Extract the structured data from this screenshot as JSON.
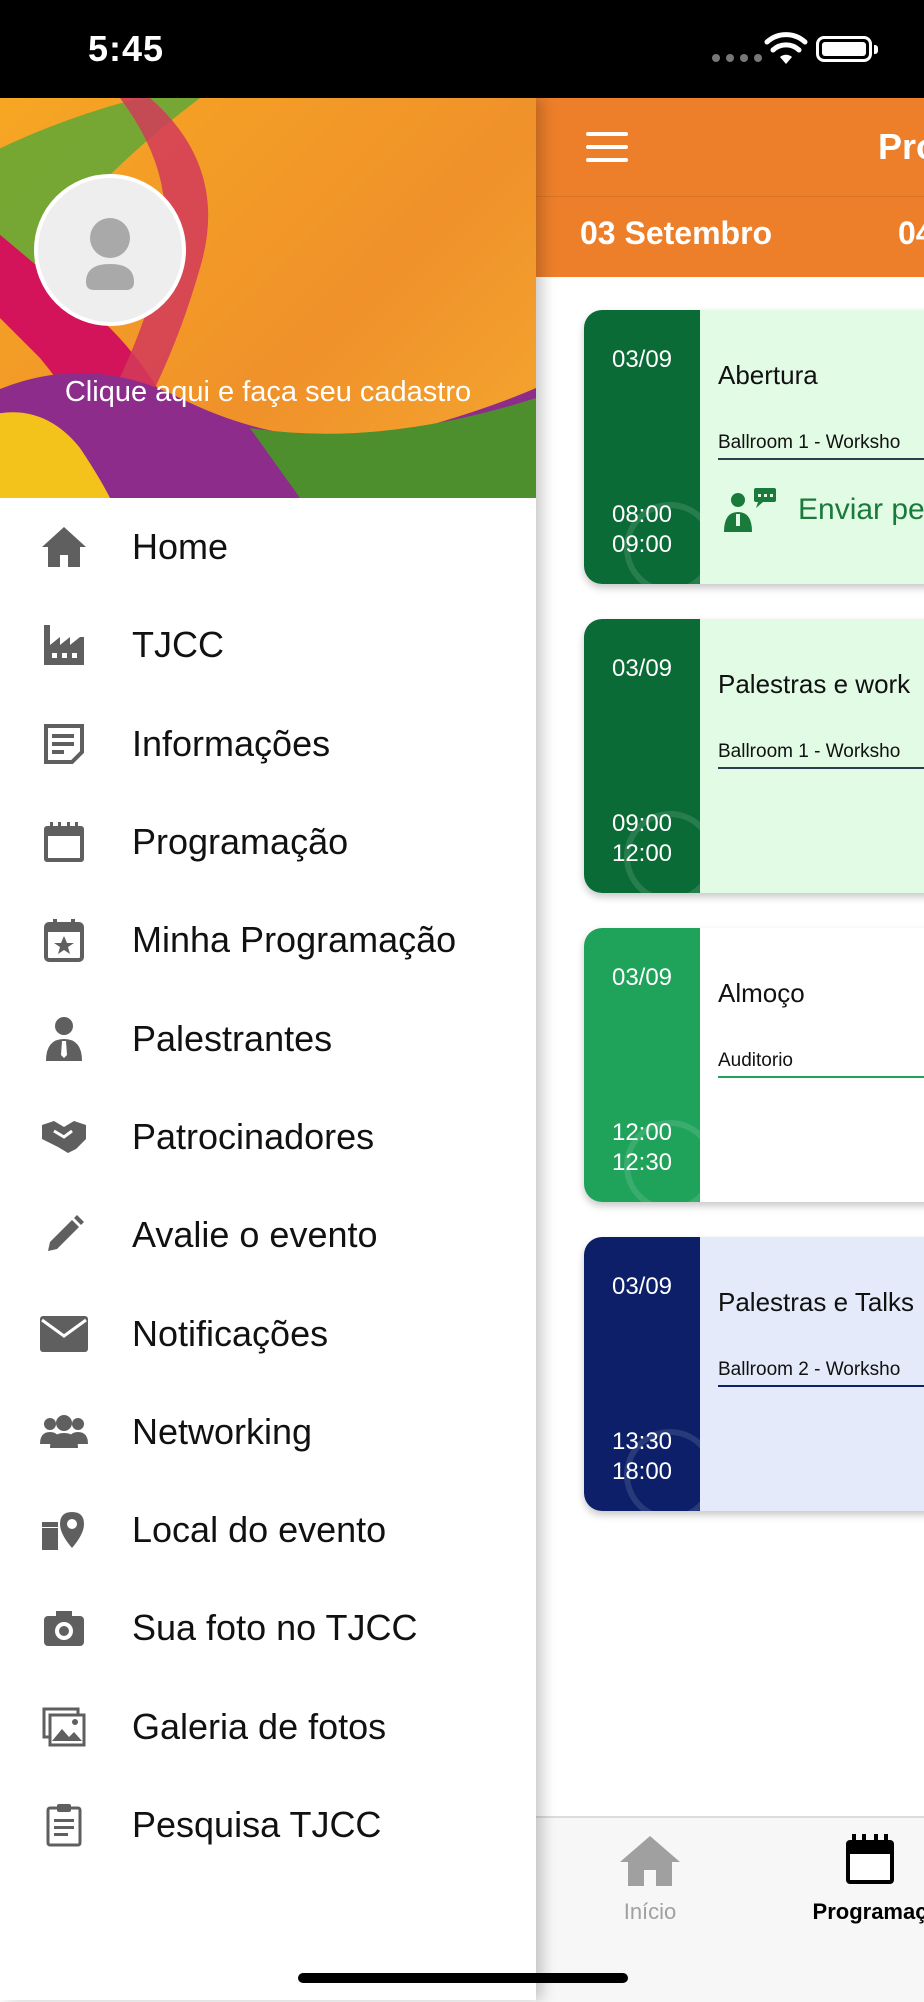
{
  "status_bar": {
    "time": "5:45"
  },
  "header": {
    "title": "Pro",
    "tabs": [
      {
        "label": "03 Setembro"
      },
      {
        "label": "04"
      }
    ]
  },
  "drawer": {
    "register_text": "Clique aqui e faça seu cadastro",
    "items": [
      {
        "label": "Home",
        "icon": "home-icon"
      },
      {
        "label": "TJCC",
        "icon": "factory-icon"
      },
      {
        "label": "Informações",
        "icon": "info-note-icon"
      },
      {
        "label": "Programação",
        "icon": "calendar-icon"
      },
      {
        "label": "Minha Programação",
        "icon": "calendar-star-icon"
      },
      {
        "label": "Palestrantes",
        "icon": "speaker-icon"
      },
      {
        "label": "Patrocinadores",
        "icon": "handshake-icon"
      },
      {
        "label": "Avalie o evento",
        "icon": "pencil-icon"
      },
      {
        "label": "Notificações",
        "icon": "mail-icon"
      },
      {
        "label": "Networking",
        "icon": "people-icon"
      },
      {
        "label": "Local do evento",
        "icon": "map-pin-icon"
      },
      {
        "label": "Sua foto no TJCC",
        "icon": "camera-icon"
      },
      {
        "label": "Galeria de fotos",
        "icon": "gallery-icon"
      },
      {
        "label": "Pesquisa TJCC",
        "icon": "clipboard-icon"
      }
    ]
  },
  "schedule": [
    {
      "date": "03/09",
      "start": "08:00",
      "end": "09:00",
      "title": "Abertura",
      "room": "Ballroom 1 - Worksho",
      "action": "Enviar pe",
      "color": "#0b6b37",
      "bg": "#e2fbe5"
    },
    {
      "date": "03/09",
      "start": "09:00",
      "end": "12:00",
      "title": "Palestras e work",
      "room": "Ballroom 1 - Worksho",
      "color": "#0b6b37",
      "bg": "#e2fbe5"
    },
    {
      "date": "03/09",
      "start": "12:00",
      "end": "12:30",
      "title": "Almoço",
      "room": "Auditorio",
      "color": "#1fa25a",
      "bg": "#ffffff"
    },
    {
      "date": "03/09",
      "start": "13:30",
      "end": "18:00",
      "title": "Palestras e Talks",
      "room": "Ballroom 2 - Worksho",
      "color": "#0c1f68",
      "bg": "#e4eaf9"
    }
  ],
  "bottom_nav": [
    {
      "label": "Início",
      "icon": "home-icon"
    },
    {
      "label": "Programaç",
      "icon": "calendar-icon"
    }
  ],
  "colors": {
    "primary": "#ee7f2a",
    "green_dark": "#0b6b37",
    "green": "#1fa25a",
    "navy": "#0c1f68",
    "icon_gray": "#5f5f5f"
  }
}
